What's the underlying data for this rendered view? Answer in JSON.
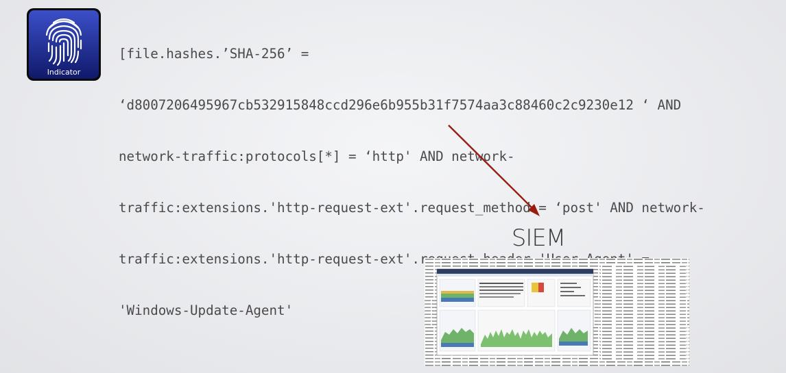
{
  "indicator": {
    "label": "Indicator",
    "icon": "fingerprint-icon",
    "colors": {
      "bg": "#1a2a8a",
      "frame": "#0b0b0b",
      "print": "#ffffff"
    }
  },
  "query_lines": [
    "[file.hashes.’SHA-256’ =",
    "‘d8007206495967cb532915848ccd296e6b955b31f7574aa3c88460c2c9230e12 ‘ AND",
    "network-traffic:protocols[*] = ‘http' AND network-",
    "traffic:extensions.'http-request-ext'.request_method = ‘post' AND network-",
    "traffic:extensions.'http-request-ext'.request_header.'User-Agent' =",
    "'Windows-Update-Agent'"
  ],
  "siem": {
    "label": "SIEM",
    "image": "siem-dashboard-screenshot"
  },
  "colors": {
    "arrow": "#9a1c10",
    "text": "#4a4a4a"
  }
}
